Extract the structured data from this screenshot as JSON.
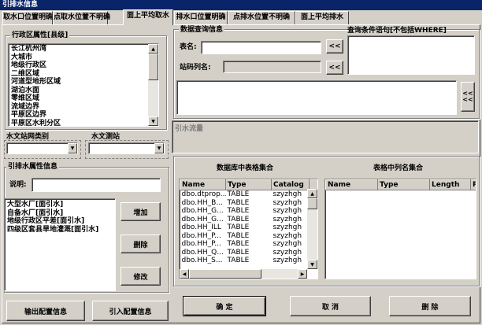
{
  "window": {
    "title": "引排水信息"
  },
  "tabs": [
    {
      "label": "取水口位置明确",
      "active": false
    },
    {
      "label": "点取水位置不明确",
      "active": false
    },
    {
      "label": "面上平均取水",
      "active": true
    },
    {
      "label": "排水口位置明确",
      "active": false
    },
    {
      "label": "点排水位置不明确",
      "active": false
    },
    {
      "label": "面上平均排水",
      "active": false
    }
  ],
  "region": {
    "group_title": "行政区属性[县级]",
    "items": [
      "长江杭州湾",
      "大城市",
      "地级行政区",
      "二维区域",
      "河道型地形区域",
      "湖泊水面",
      "零维区域",
      "流域边界",
      "平原区边界",
      "平原区水利分区"
    ]
  },
  "station_type": {
    "label": "水文站网类别",
    "value": ""
  },
  "station": {
    "label": "水文测站",
    "value": ""
  },
  "diversion": {
    "group_title": "引排水属性信息",
    "desc_label": "说明:",
    "desc_value": "",
    "items": [
      "大型水厂[面引水]",
      "自备水厂[面引水]",
      "地级行政区平差[面引水]",
      "四级区套县旱地灌溉[面引水]"
    ],
    "add_label": "增加",
    "delete_label": "删除",
    "modify_label": "修改"
  },
  "db_query": {
    "group_title": "数据查询信息",
    "table_label": "表名:",
    "table_value": "",
    "code_label": "站码列名:",
    "code_value": "",
    "arrow_label": "<<",
    "cond_title": "查询条件语句[不包括WHERE]",
    "cond_value": "",
    "sql_value": "",
    "sql_arrow": "<<"
  },
  "summary": {
    "placeholder": "引水流量"
  },
  "db_tables": {
    "title": "数据库中表格集合",
    "columns": [
      "Name",
      "Type",
      "Catalog"
    ],
    "rows": [
      [
        "dbo.dtprop...",
        "TABLE",
        "szyzhgh"
      ],
      [
        "dbo.HH_B...",
        "TABLE",
        "szyzhgh"
      ],
      [
        "dbo.HH_G...",
        "TABLE",
        "szyzhgh"
      ],
      [
        "dbo.HH_G...",
        "TABLE",
        "szyzhgh"
      ],
      [
        "dbo.HH_ILL",
        "TABLE",
        "szyzhgh"
      ],
      [
        "dbo.HH_P...",
        "TABLE",
        "szyzhgh"
      ],
      [
        "dbo.HH_P...",
        "TABLE",
        "szyzhgh"
      ],
      [
        "dbo.HH_Q...",
        "TABLE",
        "szyzhgh"
      ],
      [
        "dbo.HH_S...",
        "TABLE",
        "szyzhgh"
      ]
    ]
  },
  "col_names": {
    "title": "表格中列名集合",
    "columns": [
      "Name",
      "Type",
      "Length",
      "P"
    ]
  },
  "footer": {
    "export_label": "输出配置信息",
    "import_label": "引入配置信息",
    "ok_label": "确  定",
    "cancel_label": "取  消",
    "delete_label": "删  除"
  },
  "colors": {
    "titlebar": "#0a246a",
    "face": "#d4d0c8"
  }
}
